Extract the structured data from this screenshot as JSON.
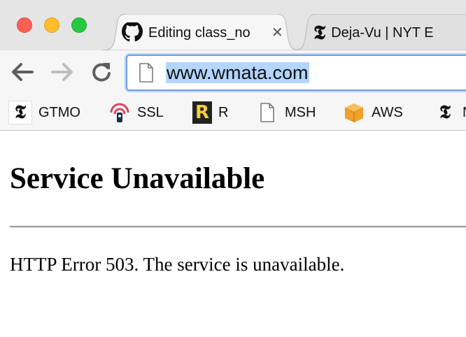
{
  "window": {
    "controls": [
      "close",
      "minimize",
      "maximize"
    ]
  },
  "tabs": [
    {
      "title": "Editing class_no",
      "icon": "github-icon",
      "active": true
    },
    {
      "title": "Deja-Vu | NYT E",
      "icon": "nyt-icon",
      "active": false
    }
  ],
  "toolbar": {
    "back_icon": "back-arrow-icon",
    "forward_icon": "forward-arrow-icon",
    "reload_icon": "reload-icon",
    "url": "www.wmata.com",
    "url_selected": true,
    "accent_color": "#6fa0e6",
    "selection_color": "#b4d5fe"
  },
  "bookmarks": [
    {
      "label": "GTMO",
      "icon": "nyt-icon"
    },
    {
      "label": "SSL",
      "icon": "ssl-lock-icon"
    },
    {
      "label": "R",
      "icon": "r-icon"
    },
    {
      "label": "MSH",
      "icon": "page-icon"
    },
    {
      "label": "AWS",
      "icon": "aws-cube-icon"
    },
    {
      "label": "N",
      "icon": "nyt-icon"
    }
  ],
  "page": {
    "title": "Service Unavailable",
    "message": "HTTP Error 503. The service is unavailable."
  }
}
